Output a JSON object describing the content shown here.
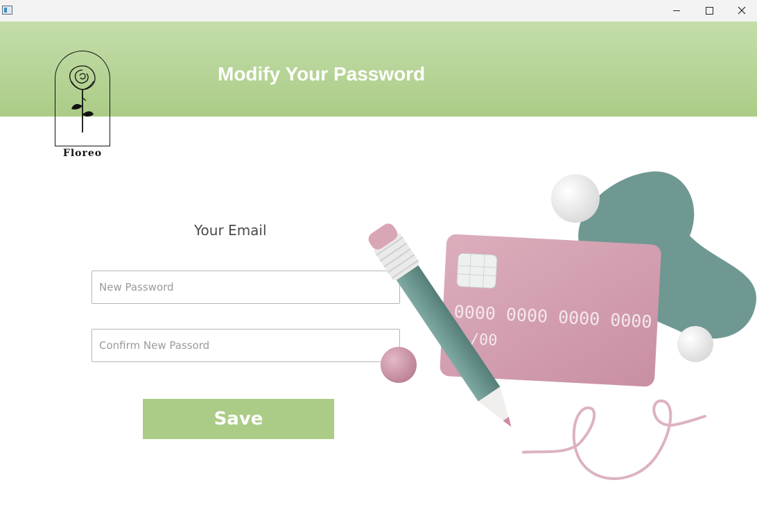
{
  "window": {
    "controls": [
      "minimize",
      "maximize",
      "close"
    ]
  },
  "header": {
    "title": "Modify Your Password",
    "logo_text": "Floreo"
  },
  "form": {
    "email_label": "Your Email",
    "new_password_placeholder": "New Password",
    "confirm_password_placeholder": "Confirm New Passord",
    "save_label": "Save"
  },
  "illustration": {
    "card_number": "0000 0000 0000 0000",
    "card_expiry": "/00"
  },
  "colors": {
    "header_green": "#abcc86",
    "button_green": "#abcc86",
    "card_pink": "#d7a5b5",
    "blob_teal": "#6f9893"
  }
}
